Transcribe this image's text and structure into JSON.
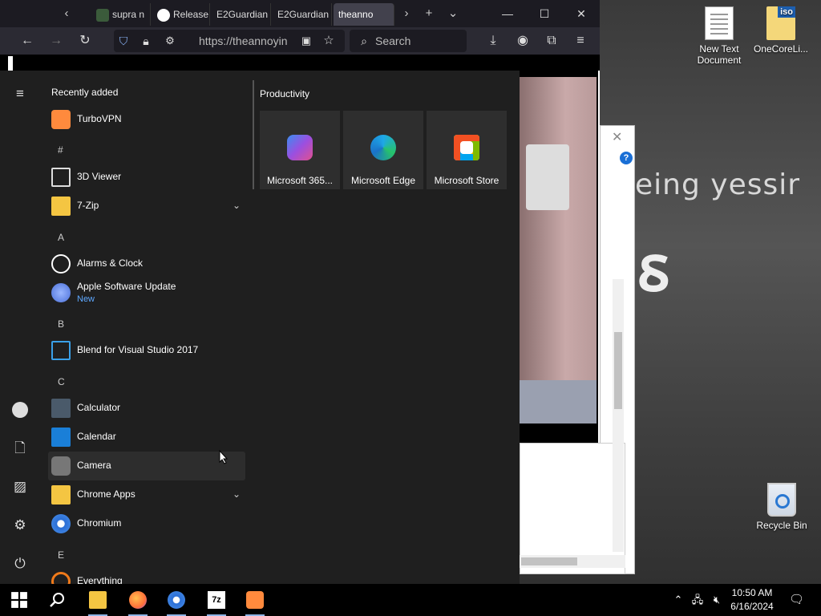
{
  "browser": {
    "tabs": [
      {
        "label": "supra n"
      },
      {
        "label": "Release"
      },
      {
        "label": "E2Guardian"
      },
      {
        "label": "E2Guardian"
      },
      {
        "label": "theanno"
      }
    ],
    "url": "https://theannoyin",
    "search_placeholder": "Search"
  },
  "wallpaper_text": "eing yessir",
  "desktop": {
    "icons": [
      {
        "label": "New Text\nDocument"
      },
      {
        "label": "OneCoreLi..."
      },
      {
        "label": "Recycle Bin"
      }
    ],
    "iso_badge": "iso"
  },
  "start_menu": {
    "recently_added_title": "Recently added",
    "letters": [
      "#",
      "A",
      "B",
      "C",
      "E"
    ],
    "apps": [
      {
        "label": "TurboVPN"
      },
      {
        "label": "3D Viewer"
      },
      {
        "label": "7-Zip"
      },
      {
        "label": "Alarms & Clock"
      },
      {
        "label": "Apple Software Update",
        "sub": "New"
      },
      {
        "label": "Blend for Visual Studio 2017"
      },
      {
        "label": "Calculator"
      },
      {
        "label": "Calendar"
      },
      {
        "label": "Camera"
      },
      {
        "label": "Chrome Apps"
      },
      {
        "label": "Chromium"
      },
      {
        "label": "Everything"
      }
    ],
    "group_title": "Productivity",
    "tiles": [
      {
        "label": "Microsoft 365..."
      },
      {
        "label": "Microsoft Edge"
      },
      {
        "label": "Microsoft Store"
      }
    ]
  },
  "taskbar": {
    "time": "10:50 AM",
    "date": "6/16/2024"
  }
}
